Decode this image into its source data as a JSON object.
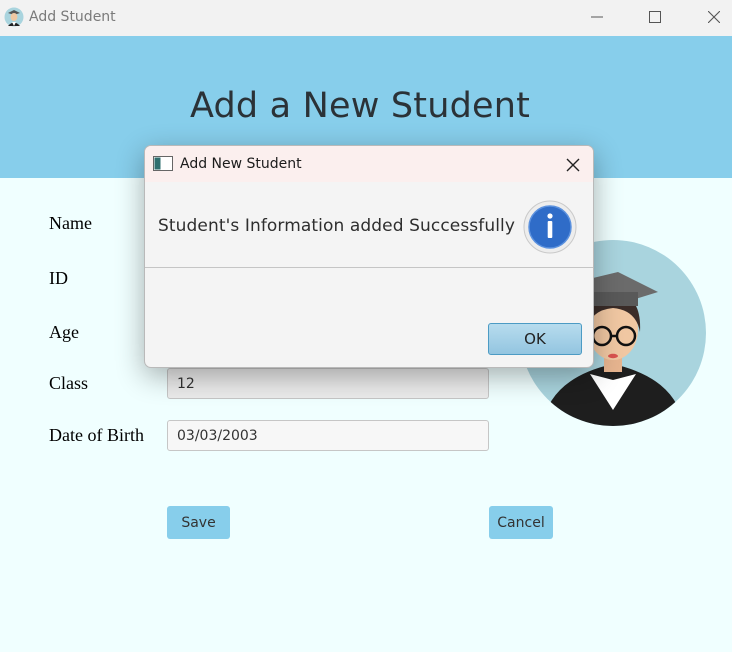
{
  "window": {
    "title": "Add Student",
    "icon": "student-avatar-icon"
  },
  "header": {
    "heading": "Add a New Student"
  },
  "form": {
    "labels": {
      "name": "Name",
      "id": "ID",
      "age": "Age",
      "class": "Class",
      "dob": "Date of Birth"
    },
    "values": {
      "class": "12",
      "dob": "03/03/2003"
    },
    "save_label": "Save",
    "cancel_label": "Cancel"
  },
  "dialog": {
    "title": "Add New Student",
    "message": "Student's Information added Successfully",
    "ok_label": "OK",
    "icon": "info-icon"
  },
  "colors": {
    "header_bg": "#87ceeb",
    "page_bg": "#f0ffff",
    "button_bg": "#87ceeb"
  }
}
